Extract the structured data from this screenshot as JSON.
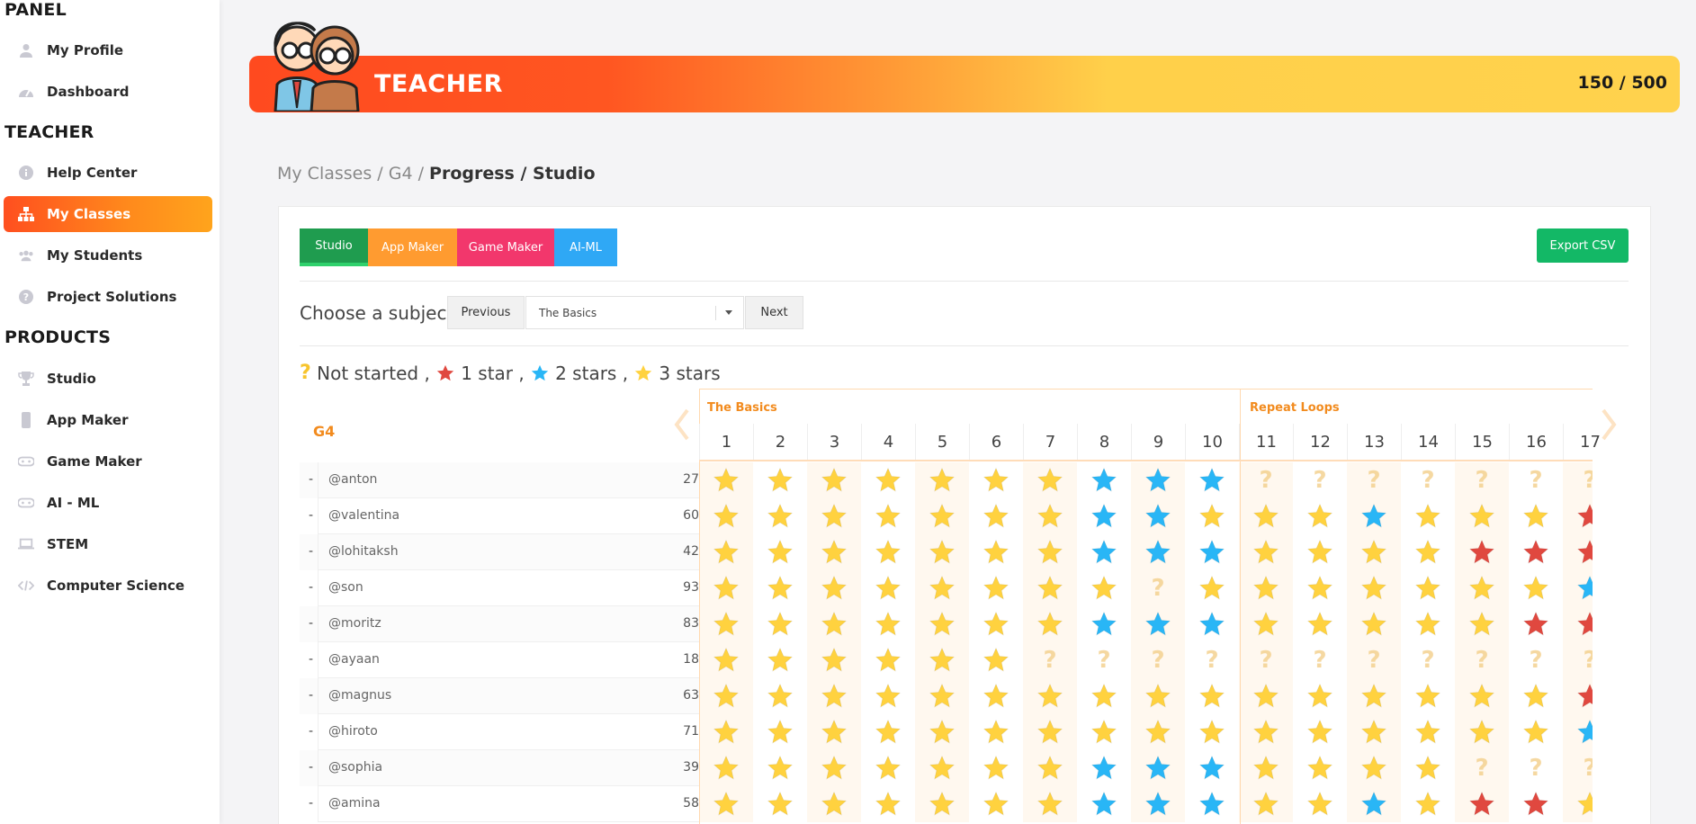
{
  "sidebar": {
    "sections": [
      {
        "title": "PANEL",
        "items": [
          {
            "label": "My Profile",
            "icon": "user-icon"
          },
          {
            "label": "Dashboard",
            "icon": "dashboard-icon"
          }
        ]
      },
      {
        "title": "TEACHER",
        "items": [
          {
            "label": "Help Center",
            "icon": "info-icon"
          },
          {
            "label": "My Classes",
            "icon": "sitemap-icon",
            "active": true
          },
          {
            "label": "My Students",
            "icon": "users-icon"
          },
          {
            "label": "Project Solutions",
            "icon": "question-icon"
          }
        ]
      },
      {
        "title": "PRODUCTS",
        "items": [
          {
            "label": "Studio",
            "icon": "trophy-icon"
          },
          {
            "label": "App Maker",
            "icon": "phone-icon"
          },
          {
            "label": "Game Maker",
            "icon": "gamepad-icon"
          },
          {
            "label": "AI - ML",
            "icon": "gamepad-icon"
          },
          {
            "label": "STEM",
            "icon": "laptop-icon"
          },
          {
            "label": "Computer Science",
            "icon": "code-icon"
          }
        ]
      }
    ]
  },
  "banner": {
    "title": "TEACHER",
    "score": "150 / 500"
  },
  "breadcrumb": {
    "part1": "My Classes",
    "sep": " / ",
    "part2": "G4",
    "current": "Progress / Studio"
  },
  "tabs": [
    "Studio",
    "App Maker",
    "Game Maker",
    "AI-ML"
  ],
  "export_label": "Export CSV",
  "subject": {
    "label": "Choose a subject:",
    "prev": "Previous",
    "selected": "The Basics",
    "next": "Next"
  },
  "legend": {
    "not_started": "Not started ,",
    "one": "1 star ,",
    "two": "2 stars ,",
    "three": "3 stars"
  },
  "class_name": "G4",
  "groups": [
    {
      "title": "The Basics",
      "columns": [
        "1",
        "2",
        "3",
        "4",
        "5",
        "6",
        "7",
        "8",
        "9",
        "10"
      ]
    },
    {
      "title": "Repeat Loops",
      "columns": [
        "11",
        "12",
        "13",
        "14",
        "15",
        "16",
        "17"
      ]
    }
  ],
  "colors": {
    "gold": "#ffd23f",
    "blue": "#29b6f6",
    "red": "#e0483f",
    "q": "#f3cf8a"
  },
  "students": [
    {
      "name": "@anton",
      "score": "27",
      "cells": "3333333222000000q"
    },
    {
      "name": "@valentina",
      "score": "60",
      "cells": "33333332233323331"
    },
    {
      "name": "@lohitaksh",
      "score": "42",
      "cells": "33333332223333111"
    },
    {
      "name": "@son",
      "score": "93",
      "cells": "33333333033333332"
    },
    {
      "name": "@moritz",
      "score": "83",
      "cells": "33333332223333311"
    },
    {
      "name": "@ayaan",
      "score": "18",
      "cells": "333333000000000000"
    },
    {
      "name": "@magnus",
      "score": "63",
      "cells": "33333333333333331"
    },
    {
      "name": "@hiroto",
      "score": "71",
      "cells": "33333333333333332"
    },
    {
      "name": "@sophia",
      "score": "39",
      "cells": "33333332223333000"
    },
    {
      "name": "@amina",
      "score": "58",
      "cells": "33333332223323113"
    }
  ]
}
